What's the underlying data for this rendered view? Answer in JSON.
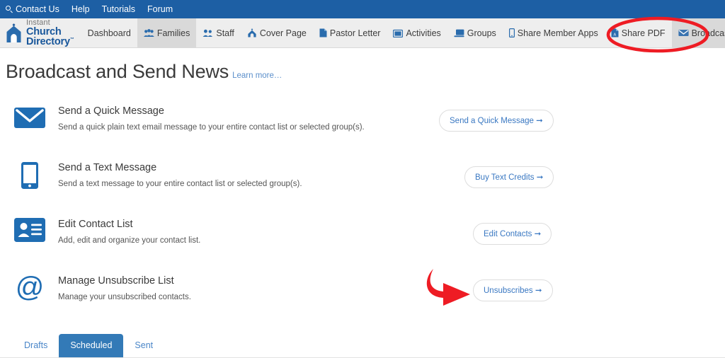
{
  "topbar": {
    "items": [
      {
        "label": "Contact Us",
        "icon": "search-icon"
      },
      {
        "label": "Help",
        "icon": ""
      },
      {
        "label": "Tutorials",
        "icon": ""
      },
      {
        "label": "Forum",
        "icon": ""
      }
    ]
  },
  "brand": {
    "line1": "Instant",
    "line2": "Church Directory",
    "trademark": "™",
    "icon": "church-icon"
  },
  "nav": {
    "items": [
      {
        "label": "Dashboard",
        "icon": "",
        "active": false
      },
      {
        "label": "Families",
        "icon": "people-icon",
        "active": true
      },
      {
        "label": "Staff",
        "icon": "staff-people-icon",
        "active": false
      },
      {
        "label": "Cover Page",
        "icon": "church-small-icon",
        "active": false
      },
      {
        "label": "Pastor Letter",
        "icon": "document-icon",
        "active": false
      },
      {
        "label": "Activities",
        "icon": "calendar-image-icon",
        "active": false
      },
      {
        "label": "Groups",
        "icon": "monitor-icon",
        "active": false
      },
      {
        "label": "Share Member Apps",
        "icon": "mobile-icon",
        "active": false
      },
      {
        "label": "Share PDF",
        "icon": "pdf-icon",
        "active": false
      },
      {
        "label": "Broadcast News",
        "icon": "envelope-icon",
        "active": true
      }
    ]
  },
  "header": {
    "title": "Broadcast and Send News",
    "learn_more": "Learn more…"
  },
  "sections": [
    {
      "icon": "envelope-icon",
      "title": "Send a Quick Message",
      "description": "Send a quick plain text email message to your entire contact list or selected group(s).",
      "button": "Send a Quick Message  ➞"
    },
    {
      "icon": "mobile-phone-icon",
      "title": "Send a Text Message",
      "description": "Send a text message to your entire contact list or selected group(s).",
      "button": "Buy Text Credits  ➞"
    },
    {
      "icon": "contact-card-icon",
      "title": "Edit Contact List",
      "description": "Add, edit and organize your contact list.",
      "button": "Edit Contacts  ➞"
    },
    {
      "icon": "at-sign-icon",
      "title": "Manage Unsubscribe List",
      "description": "Manage your unsubscribed contacts.",
      "button": "Unsubscribes  ➞"
    }
  ],
  "tabs": [
    {
      "label": "Drafts",
      "active": false
    },
    {
      "label": "Scheduled",
      "active": true
    },
    {
      "label": "Sent",
      "active": false
    }
  ],
  "annotations": [
    {
      "name": "red-ellipse-highlight",
      "target": "Broadcast News",
      "color": "#ee1c24"
    },
    {
      "name": "red-curved-arrow",
      "target": "Unsubscribes",
      "color": "#ee1c24"
    }
  ],
  "colors": {
    "topbar_blue": "#1d5fa4",
    "brand_blue": "#19579b",
    "icon_blue": "#2a7ab9",
    "link_blue": "#3a78c2",
    "tab_active_blue": "#337ab7",
    "annotation_red": "#ee1c24"
  }
}
